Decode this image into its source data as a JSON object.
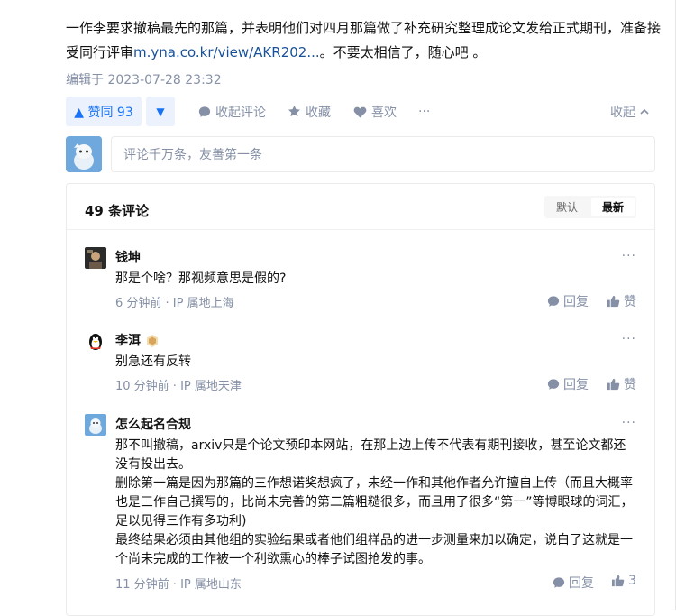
{
  "answer": {
    "text_before_link": "一作李要求撤稿最先的那篇，并表明他们对四月那篇做了补充研究整理成论文发给正式期刊，准备接受同行评审",
    "link": "m.yna.co.kr/view/AKR202...",
    "text_after_link": "。不要太相信了，随心吧 。",
    "edit_time": "编辑于 2023-07-28 23:32"
  },
  "actions": {
    "vote_up": "▲ 赞同 93",
    "vote_down": "▼",
    "collapse_comments": "收起评论",
    "favorite": "收藏",
    "like": "喜欢",
    "more": "···",
    "collapse": "收起"
  },
  "comment_input": {
    "placeholder": "评论千万条，友善第一条"
  },
  "comments_header": {
    "count": "49 条评论",
    "sort_default": "默认",
    "sort_latest": "最新"
  },
  "comments": [
    {
      "author": "钱坤",
      "text": "那是个啥？那视频意思是假的?",
      "meta": "6 分钟前 · IP 属地上海",
      "reply": "回复",
      "like": "赞"
    },
    {
      "author": "李洱",
      "text": "别急还有反转",
      "meta": "10 分钟前 · IP 属地天津",
      "reply": "回复",
      "like": "赞"
    },
    {
      "author": "怎么起名合规",
      "text_lines": [
        "那不叫撤稿，arxiv只是个论文预印本网站，在那上边上传不代表有期刊接收，甚至论文都还没有投出去。",
        "删除第一篇是因为那篇的三作想诺奖想疯了，未经一作和其他作者允许擅自上传（而且大概率也是三作自己撰写的，比尚未完善的第二篇粗糙很多，而且用了很多“第一”等博眼球的词汇，足以见得三作有多功利)",
        "最终结果必须由其他组的实验结果或者他们组样品的进一步测量来加以确定，说白了这就是一个尚未完成的工作被一个利欲熏心的棒子试图抢发的事。"
      ],
      "meta": "11 分钟前 · IP 属地山东",
      "reply": "回复",
      "like": "3"
    }
  ],
  "colors": {
    "brand_blue": "#1772f6",
    "vote_bg": "#ebf2fd",
    "muted_text": "#8590a6",
    "link": "#175199"
  }
}
